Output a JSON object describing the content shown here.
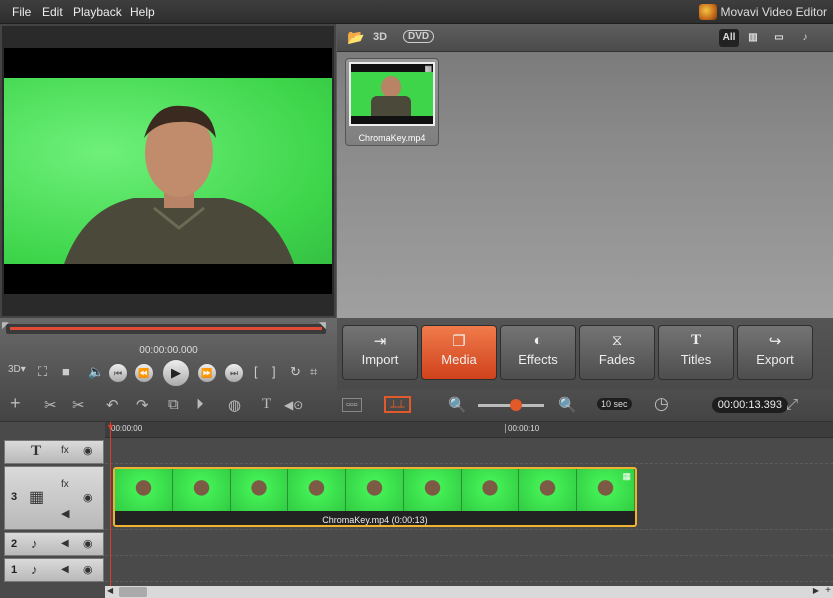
{
  "menu": {
    "file": "File",
    "edit": "Edit",
    "playback": "Playback",
    "help": "Help",
    "brand": "Movavi Video Editor"
  },
  "media_toolbar": {
    "three_d": "3D",
    "dvd": "DVD",
    "filter_all": "All"
  },
  "media_items": [
    {
      "name": "ChromaKey.mp4"
    }
  ],
  "player": {
    "timecode": "00:00:00.000",
    "progress": 0.0
  },
  "tabs": [
    {
      "label": "Import",
      "icon": "import-icon"
    },
    {
      "label": "Media",
      "icon": "media-icon",
      "active": true
    },
    {
      "label": "Effects",
      "icon": "effects-icon"
    },
    {
      "label": "Fades",
      "icon": "fades-icon"
    },
    {
      "label": "Titles",
      "icon": "titles-icon"
    },
    {
      "label": "Export",
      "icon": "export-icon"
    }
  ],
  "timeline_toolbar": {
    "zoom_value": "10 sec",
    "duration": "00:00:13.393"
  },
  "ruler": {
    "start": "00:00:00",
    "mark": "00:00:10"
  },
  "tracks": [
    {
      "number": "",
      "type": "title"
    },
    {
      "number": "3",
      "type": "video"
    },
    {
      "number": "2",
      "type": "audio"
    },
    {
      "number": "1",
      "type": "audio"
    }
  ],
  "clip": {
    "label": "ChromaKey.mp4 (0:00:13)"
  },
  "colors": {
    "accent": "#e25a2a",
    "clip_border": "#f0b330",
    "playhead": "#e03a28"
  }
}
